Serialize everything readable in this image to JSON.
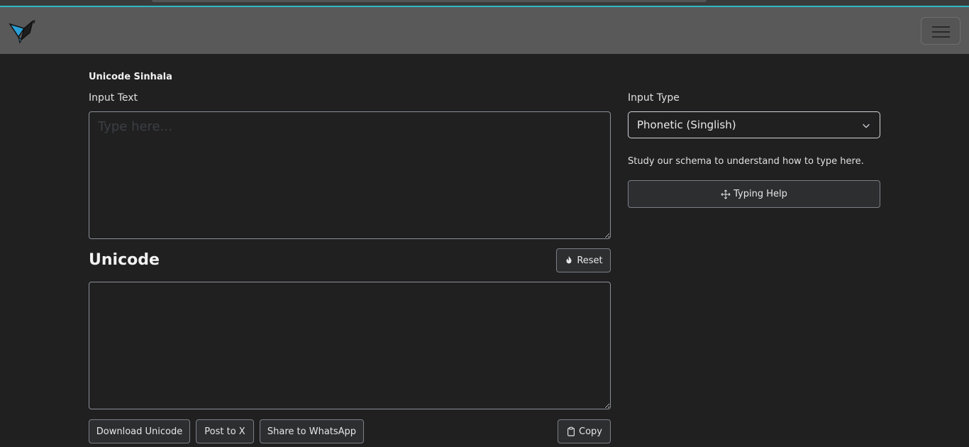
{
  "navbar": {
    "logo_icon": "origami-bird-icon",
    "menu_icon": "hamburger-menu-icon"
  },
  "page": {
    "title": "Unicode Sinhala"
  },
  "input": {
    "label": "Input Text",
    "placeholder": "Type here..."
  },
  "output": {
    "heading": "Unicode",
    "reset_label": "Reset",
    "value": ""
  },
  "actions": {
    "download_label": "Download Unicode",
    "post_x_label": "Post to X",
    "whatsapp_label": "Share to WhatsApp",
    "copy_label": "Copy"
  },
  "sidebar": {
    "input_type_label": "Input Type",
    "input_type_selected": "Phonetic (Singlish)",
    "help_text": "Study our schema to understand how to type here.",
    "typing_help_label": "Typing Help"
  },
  "colors": {
    "background": "#202021",
    "navbar": "#595959",
    "accent": "#2fb7c9"
  }
}
